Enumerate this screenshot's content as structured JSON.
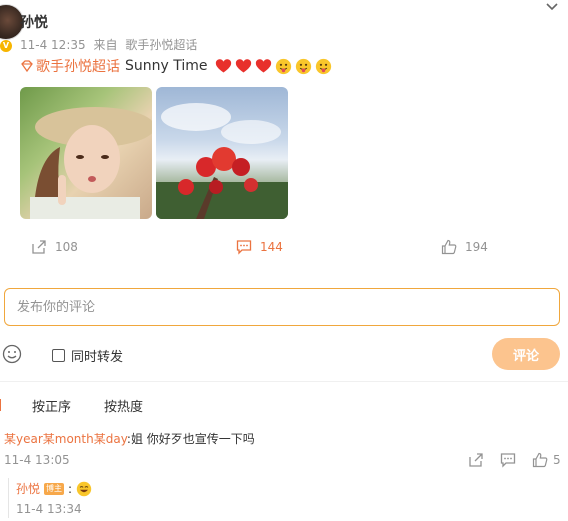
{
  "post": {
    "author": "孙悦",
    "time": "11-4 12:35",
    "source_prefix": "来自",
    "source": "歌手孙悦超话",
    "topic": "歌手孙悦超话",
    "text": "Sunny Time",
    "emojis": [
      "heart",
      "heart",
      "heart",
      "tongue-face",
      "tongue-face",
      "tongue-face"
    ]
  },
  "actions": {
    "share_count": "108",
    "comment_count": "144",
    "like_count": "194"
  },
  "composer": {
    "placeholder": "发布你的评论",
    "repost_label": "同时转发",
    "submit_label": "评论"
  },
  "sort": {
    "by_time": "按正序",
    "by_hot": "按热度"
  },
  "comments": [
    {
      "user": "某year某month某day",
      "text": ":姐 你好歹也宣传一下吗",
      "time": "11-4 13:05",
      "like_count": "5",
      "replies": [
        {
          "user": "孙悦",
          "badge": "博主",
          "text": ":",
          "time": "11-4 13:34"
        }
      ]
    }
  ],
  "colors": {
    "accent": "#eb7340",
    "border_focus": "#f0a73d",
    "submit_disabled": "#fcc48e",
    "muted": "#939393"
  }
}
